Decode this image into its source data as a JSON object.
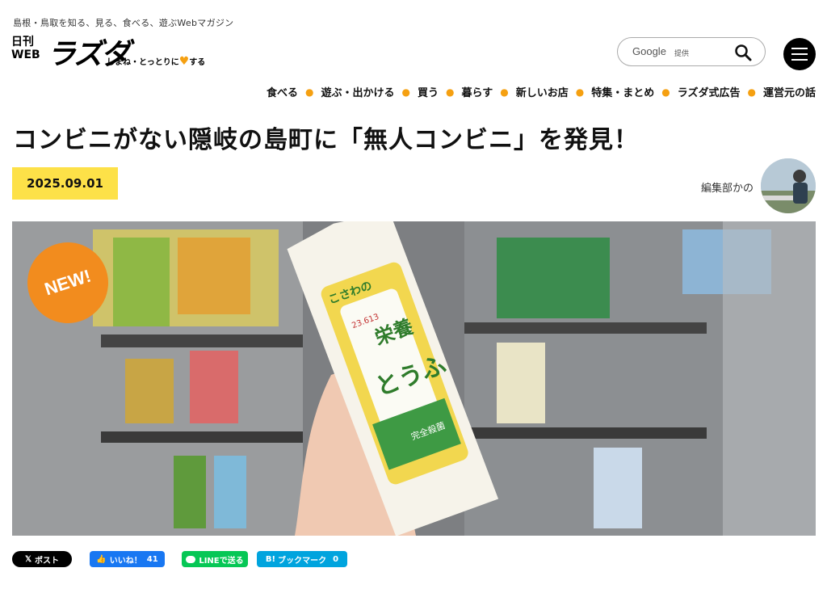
{
  "header": {
    "tagline": "島根・鳥取を知る、見る、食べる、遊ぶWebマガジン",
    "logo": {
      "small_top": "日刊",
      "small_bottom": "WEB",
      "name": "ラズダ",
      "sub_before": "しまね・とっとりに",
      "sub_after": "する"
    },
    "search": {
      "brand": "Google",
      "suffix": "提供"
    }
  },
  "nav": [
    "食べる",
    "遊ぶ・出かける",
    "買う",
    "暮らす",
    "新しいお店",
    "特集・まとめ",
    "ラズダ式広告",
    "運営元の話"
  ],
  "article": {
    "title": "コンビニがない隠岐の島町に「無人コンビニ」を発見！",
    "date": "2025.09.01",
    "author": "編集部かの",
    "badge": "NEW!"
  },
  "package": {
    "brand": "こさわの",
    "product_top": "栄養",
    "product_bottom": "とうふ",
    "stamp": "23.613",
    "label": "完全殺菌"
  },
  "share": {
    "x": "ポスト",
    "fb_label": "いいね！",
    "fb_count": "41",
    "line": "LINEで送る",
    "hb_label": "ブックマーク",
    "hb_count": "0"
  },
  "colors": {
    "accent": "#f5a011",
    "date_bg": "#fde148",
    "badge": "#f28c1e"
  }
}
